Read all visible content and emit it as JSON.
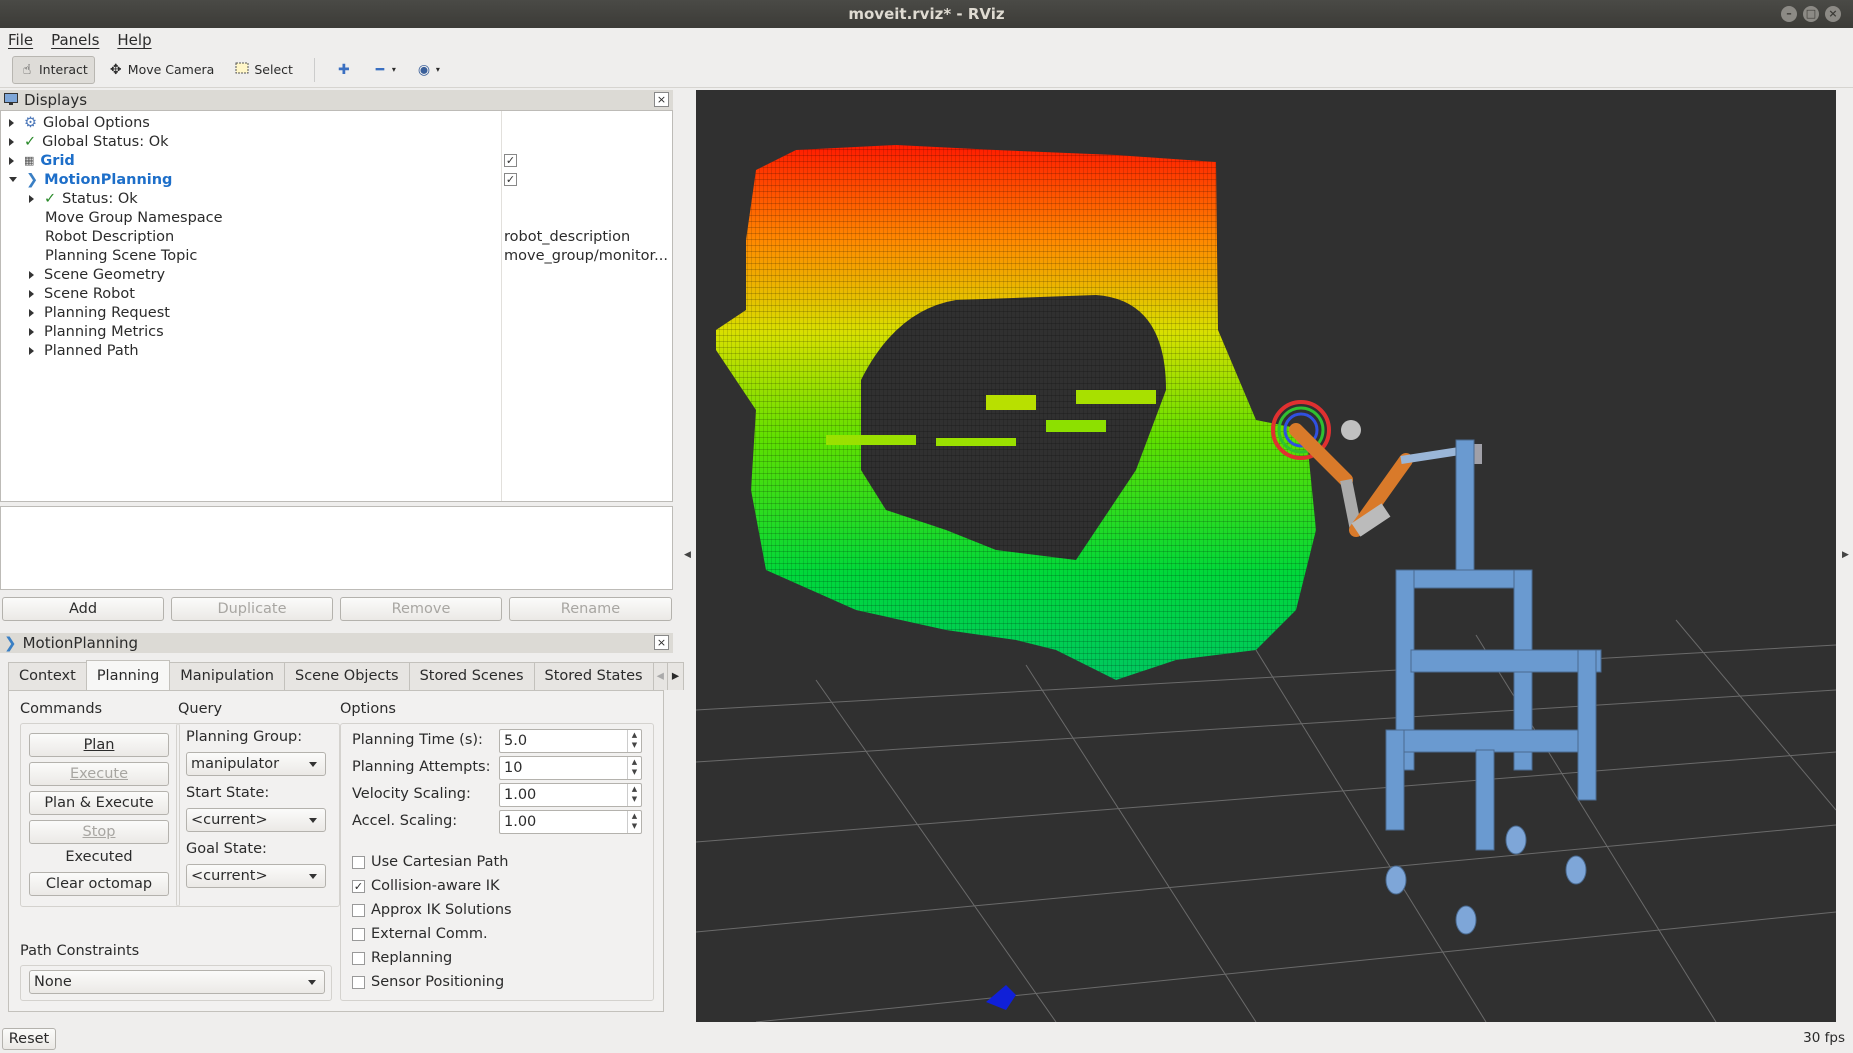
{
  "window": {
    "title": "moveit.rviz* - RViz"
  },
  "menu": [
    "File",
    "Panels",
    "Help"
  ],
  "toolbar": {
    "interact": "Interact",
    "move_camera": "Move Camera",
    "select": "Select"
  },
  "displays": {
    "title": "Displays",
    "items": [
      {
        "label": "Global Options"
      },
      {
        "label": "Global Status: Ok"
      },
      {
        "label": "Grid"
      },
      {
        "label": "MotionPlanning"
      },
      {
        "label": "Status: Ok"
      },
      {
        "label": "Move Group Namespace",
        "value": ""
      },
      {
        "label": "Robot Description",
        "value": "robot_description"
      },
      {
        "label": "Planning Scene Topic",
        "value": "move_group/monitor..."
      },
      {
        "label": "Scene Geometry"
      },
      {
        "label": "Scene Robot"
      },
      {
        "label": "Planning Request"
      },
      {
        "label": "Planning Metrics"
      },
      {
        "label": "Planned Path"
      }
    ],
    "buttons": {
      "add": "Add",
      "duplicate": "Duplicate",
      "remove": "Remove",
      "rename": "Rename"
    }
  },
  "motion_planning": {
    "title": "MotionPlanning",
    "tabs": [
      "Context",
      "Planning",
      "Manipulation",
      "Scene Objects",
      "Stored Scenes",
      "Stored States"
    ],
    "active_tab": "Planning",
    "commands": {
      "heading": "Commands",
      "plan": "Plan",
      "execute": "Execute",
      "plan_execute": "Plan & Execute",
      "stop": "Stop",
      "status": "Executed",
      "clear_octomap": "Clear octomap"
    },
    "query": {
      "heading": "Query",
      "planning_group_label": "Planning Group:",
      "planning_group": "manipulator",
      "start_state_label": "Start State:",
      "start_state": "<current>",
      "goal_state_label": "Goal State:",
      "goal_state": "<current>"
    },
    "options": {
      "heading": "Options",
      "planning_time_label": "Planning Time (s):",
      "planning_time": "5.0",
      "planning_attempts_label": "Planning Attempts:",
      "planning_attempts": "10",
      "velocity_scaling_label": "Velocity Scaling:",
      "velocity_scaling": "1.00",
      "accel_scaling_label": "Accel. Scaling:",
      "accel_scaling": "1.00",
      "checkboxes": [
        {
          "label": "Use Cartesian Path",
          "checked": false
        },
        {
          "label": "Collision-aware IK",
          "checked": true
        },
        {
          "label": "Approx IK Solutions",
          "checked": false
        },
        {
          "label": "External Comm.",
          "checked": false
        },
        {
          "label": "Replanning",
          "checked": false
        },
        {
          "label": "Sensor Positioning",
          "checked": false
        }
      ]
    },
    "path_constraints": {
      "heading": "Path Constraints",
      "value": "None"
    }
  },
  "status": {
    "reset": "Reset",
    "fps": "30 fps"
  }
}
